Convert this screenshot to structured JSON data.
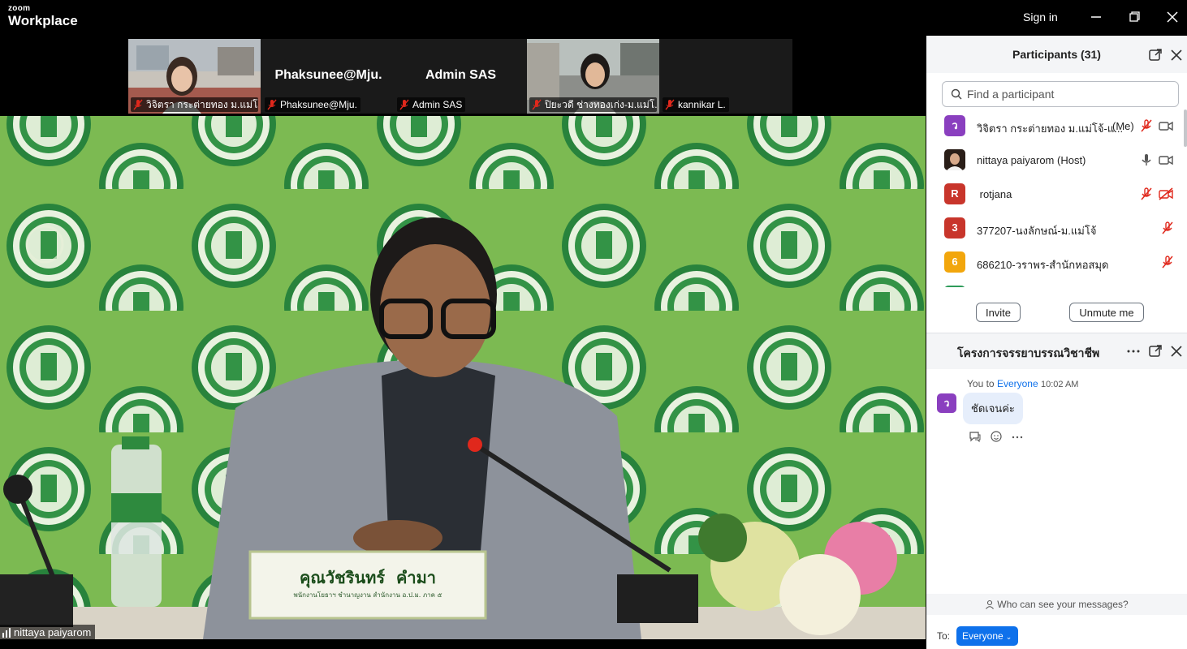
{
  "titlebar": {
    "logo_small": "zoom",
    "logo_big": "Workplace",
    "sign_in": "Sign in"
  },
  "filmstrip": [
    {
      "label": "วิจิตรา กระต่ายทอง ม.แม่โ...",
      "has_video": true,
      "muted": true
    },
    {
      "label": "Phaksunee@Mju.",
      "big_name": "Phaksunee@Mju.",
      "has_video": false,
      "muted": true
    },
    {
      "label": "Admin SAS",
      "big_name": "Admin SAS",
      "has_video": false,
      "muted": true
    },
    {
      "label": "ปิยะวดี ช่างทองเก่ง-ม.แม่โ...",
      "has_video": true,
      "muted": true
    },
    {
      "label": "kannikar L.",
      "has_video": false,
      "muted": true
    }
  ],
  "main_video": {
    "speaker_name": "nittaya paiyarom",
    "nameplate": "คุณวัชรินทร์  คำมา",
    "nameplate_sub": "พนักงานโยธาฯ ชำนาญงาน สำนักงาน อ.ป.ม. ภาค ๕"
  },
  "participants": {
    "title": "Participants (31)",
    "search_placeholder": "Find a participant",
    "list": [
      {
        "avatar": "ว",
        "avatar_color": "#8a3fbf",
        "name": "วิจิตรา กระต่ายทอง ม.แม่โจ้-แ...",
        "tag": "(Me)",
        "mic": "muted",
        "video": "on"
      },
      {
        "avatar": "",
        "avatar_color": "#3a2a22",
        "name": "nittaya paiyarom (Host)",
        "tag": "",
        "mic": "on",
        "video": "on"
      },
      {
        "avatar": "R",
        "avatar_color": "#c8352b",
        "name": " rotjana",
        "tag": "",
        "mic": "muted",
        "video": "off"
      },
      {
        "avatar": "3",
        "avatar_color": "#c8352b",
        "name": "377207-นงลักษณ์-ม.แม่โจ้",
        "tag": "",
        "mic": "muted",
        "video": "none"
      },
      {
        "avatar": "6",
        "avatar_color": "#f2a60c",
        "name": "686210-วราพร-สำนักหอสมุด",
        "tag": "",
        "mic": "muted",
        "video": "none"
      }
    ],
    "invite_label": "Invite",
    "unmute_label": "Unmute me"
  },
  "chat": {
    "title": "โครงการจรรยาบรรณวิชาชีพ",
    "message": {
      "from": "You to",
      "to": "Everyone",
      "time": "10:02 AM",
      "avatar": "ว",
      "text": "ชัดเจนค่ะ"
    },
    "who_can_see": "Who can see your messages?",
    "to_label": "To:",
    "recipient": "Everyone"
  },
  "colors": {
    "accent": "#0e71eb",
    "muted_red": "#e0281c",
    "panel_header": "#f4f5f7",
    "background_green": "#7cba52"
  }
}
